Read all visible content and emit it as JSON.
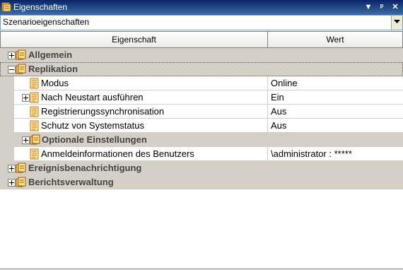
{
  "window": {
    "title": "Eigenschaften",
    "buttons": {
      "menu": "▼",
      "pin": "ᵖ",
      "close": "✕"
    }
  },
  "combo": {
    "value": "Szenarioeigenschaften"
  },
  "header": {
    "property": "Eigenschaft",
    "value": "Wert"
  },
  "rows": [
    {
      "kind": "category",
      "label": "Allgemein",
      "expanded": false
    },
    {
      "kind": "category",
      "label": "Replikation",
      "expanded": true
    },
    {
      "kind": "property",
      "label": "Modus",
      "value": "Online"
    },
    {
      "kind": "property",
      "label": "Nach Neustart ausführen",
      "value": "Ein",
      "expandable": true
    },
    {
      "kind": "property",
      "label": "Registrierungssynchronisation",
      "value": "Aus"
    },
    {
      "kind": "property",
      "label": "Schutz von Systemstatus",
      "value": "Aus"
    },
    {
      "kind": "subcategory",
      "label": "Optionale Einstellungen",
      "expanded": false
    },
    {
      "kind": "property",
      "label": "Anmeldeinformationen des Benutzers",
      "value": "\\administrator : *****"
    },
    {
      "kind": "category",
      "label": "Ereignisbenachrichtigung",
      "expanded": false
    },
    {
      "kind": "category",
      "label": "Berichtsverwaltung",
      "expanded": false
    }
  ],
  "colors": {
    "title_bar": "#0a246a",
    "category_bg": "#d4d0c8",
    "icon_orange": "#f0a030"
  }
}
